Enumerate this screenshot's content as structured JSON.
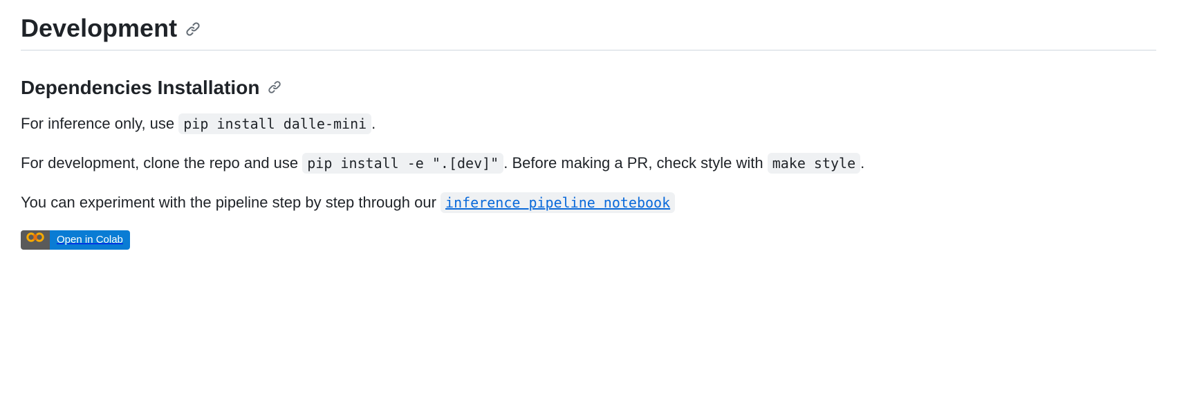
{
  "heading": "Development",
  "subheading": "Dependencies Installation",
  "p1": {
    "pre": "For inference only, use ",
    "code": "pip install dalle-mini",
    "post": "."
  },
  "p2": {
    "pre": "For development, clone the repo and use ",
    "code1": "pip install -e \".[dev]\"",
    "mid": ". Before making a PR, check style with ",
    "code2": "make style",
    "post": "."
  },
  "p3": {
    "pre": "You can experiment with the pipeline step by step through our ",
    "linkcode": "inference pipeline notebook"
  },
  "badge": {
    "label": "Open in Colab"
  }
}
